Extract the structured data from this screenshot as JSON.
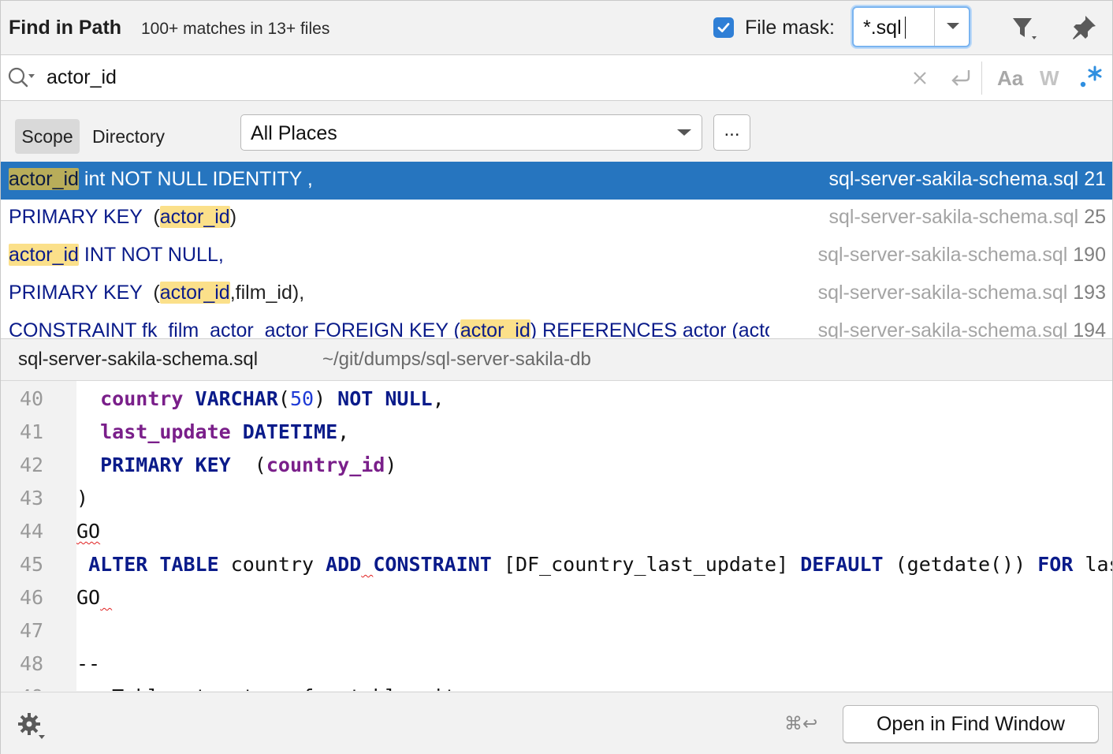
{
  "header": {
    "title": "Find in Path",
    "match_count": "100+ matches in 13+ files",
    "file_mask_label": "File mask:",
    "file_mask_checked": true,
    "file_mask_value": "*.sql"
  },
  "search": {
    "query": "actor_id",
    "case_label": "Aa",
    "word_label": "W",
    "regex_label": ".*"
  },
  "scope": {
    "scope_tab": "Scope",
    "directory_tab": "Directory",
    "places_value": "All Places",
    "browse_label": "..."
  },
  "results": [
    {
      "selected": true,
      "segments": [
        {
          "t": "actor_id",
          "h": true
        },
        {
          "t": " int NOT NULL IDENTITY ,",
          "h": false
        }
      ],
      "file": "sql-server-sakila-schema.sql",
      "line": "21"
    },
    {
      "selected": false,
      "segments": [
        {
          "t": "PRIMARY KEY  ",
          "h": false
        },
        {
          "t": "(",
          "h": false,
          "p": true
        },
        {
          "t": "actor_id",
          "h": true
        },
        {
          "t": ")",
          "h": false,
          "p": true
        }
      ],
      "file": "sql-server-sakila-schema.sql",
      "line": "25"
    },
    {
      "selected": false,
      "segments": [
        {
          "t": "actor_id",
          "h": true
        },
        {
          "t": " INT NOT NULL,",
          "h": false
        }
      ],
      "file": "sql-server-sakila-schema.sql",
      "line": "190"
    },
    {
      "selected": false,
      "segments": [
        {
          "t": "PRIMARY KEY  ",
          "h": false
        },
        {
          "t": "(",
          "h": false,
          "p": true
        },
        {
          "t": "actor_id",
          "h": true
        },
        {
          "t": ",film_id),",
          "h": false,
          "p": true
        }
      ],
      "file": "sql-server-sakila-schema.sql",
      "line": "193"
    },
    {
      "selected": false,
      "segments": [
        {
          "t": "CONSTRAINT fk_film_actor_actor FOREIGN KEY (",
          "h": false
        },
        {
          "t": "actor_id",
          "h": true
        },
        {
          "t": ") REFERENCES actor (actor_id)",
          "h": false
        }
      ],
      "file": "sql-server-sakila-schema.sql",
      "line": "194"
    }
  ],
  "preview": {
    "file_name": "sql-server-sakila-schema.sql",
    "file_path": "~/git/dumps/sql-server-sakila-db"
  },
  "code_lines": [
    {
      "n": "40",
      "tokens": [
        {
          "t": "  "
        },
        {
          "t": "country",
          "c": "id"
        },
        {
          "t": " "
        },
        {
          "t": "VARCHAR",
          "c": "kw"
        },
        {
          "t": "("
        },
        {
          "t": "50",
          "c": "num"
        },
        {
          "t": ") "
        },
        {
          "t": "NOT NULL",
          "c": "kw"
        },
        {
          "t": ","
        }
      ]
    },
    {
      "n": "41",
      "tokens": [
        {
          "t": "  "
        },
        {
          "t": "last_update",
          "c": "id"
        },
        {
          "t": " "
        },
        {
          "t": "DATETIME",
          "c": "kw"
        },
        {
          "t": ","
        }
      ]
    },
    {
      "n": "42",
      "tokens": [
        {
          "t": "  "
        },
        {
          "t": "PRIMARY KEY",
          "c": "kw"
        },
        {
          "t": "  ("
        },
        {
          "t": "country_id",
          "c": "id"
        },
        {
          "t": ")"
        }
      ]
    },
    {
      "n": "43",
      "tokens": [
        {
          "t": ")"
        }
      ]
    },
    {
      "n": "44",
      "tokens": [
        {
          "t": "GO",
          "c": "squig"
        }
      ]
    },
    {
      "n": "45",
      "tokens": [
        {
          "t": " "
        },
        {
          "t": "ALTER TABLE",
          "c": "kw"
        },
        {
          "t": " country "
        },
        {
          "t": "ADD",
          "c": "kw"
        },
        {
          "t": " ",
          "c": "squig"
        },
        {
          "t": "CONSTRAINT",
          "c": "kw"
        },
        {
          "t": " [DF_country_last_update] "
        },
        {
          "t": "DEFAULT",
          "c": "kw"
        },
        {
          "t": " (getdate()) "
        },
        {
          "t": "FOR",
          "c": "kw"
        },
        {
          "t": " last_update"
        }
      ]
    },
    {
      "n": "46",
      "tokens": [
        {
          "t": "GO"
        },
        {
          "t": " ",
          "c": "squig"
        }
      ]
    },
    {
      "n": "47",
      "tokens": []
    },
    {
      "n": "48",
      "tokens": [
        {
          "t": "--"
        }
      ]
    },
    {
      "n": "49",
      "tokens": [
        {
          "t": "-- Table structure for table city"
        }
      ]
    }
  ],
  "footer": {
    "shortcut": "⌘↩",
    "open_button": "Open in Find Window"
  },
  "colors": {
    "accent": "#2675bf",
    "match_highlight": "#fbe08a",
    "keyword": "#0a1b8a",
    "identifier": "#7a1f8a",
    "number": "#1f3bd6"
  },
  "icons": [
    "checkbox-checked-icon",
    "chevron-down-icon",
    "filter-icon",
    "pin-icon",
    "search-icon",
    "clear-icon",
    "newline-icon",
    "regex-icon",
    "gear-icon"
  ]
}
